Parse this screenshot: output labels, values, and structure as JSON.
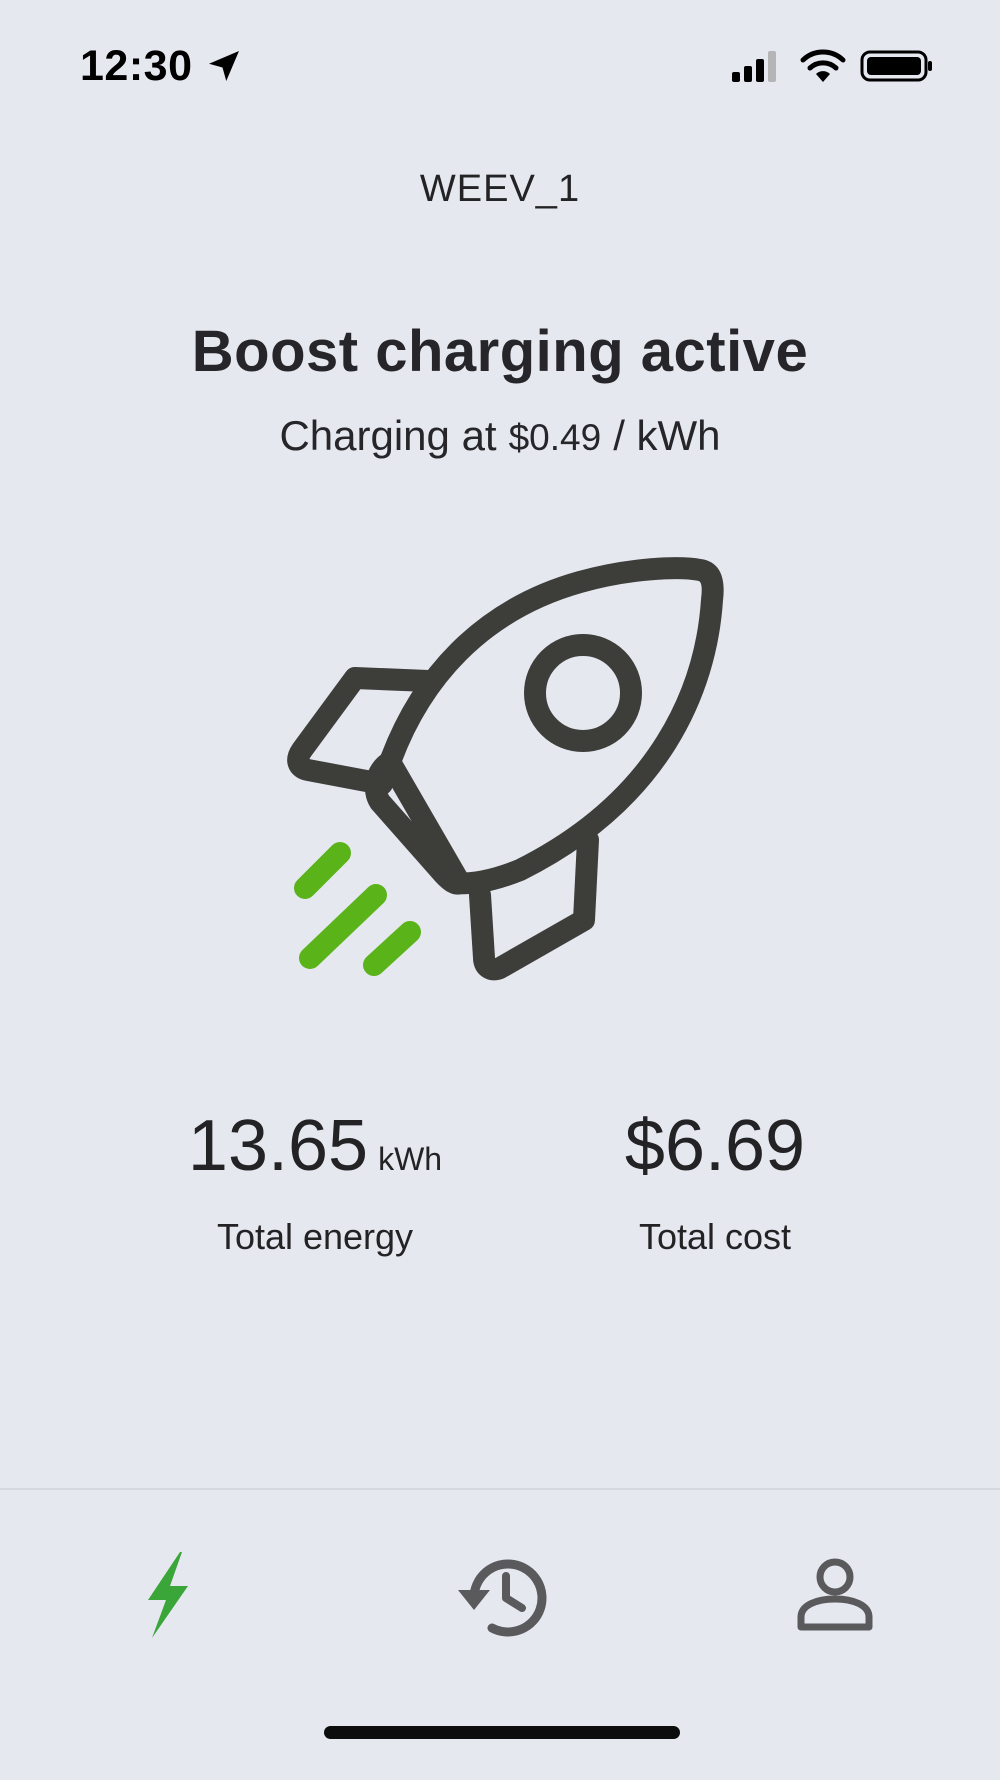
{
  "status_bar": {
    "time": "12:30"
  },
  "header": {
    "device_name": "WEEV_1"
  },
  "main": {
    "title": "Boost charging active",
    "rate_prefix": "Charging at",
    "rate_value": "$0.49",
    "rate_suffix": "/ kWh",
    "illustration_icon": "rocket-icon"
  },
  "stats": {
    "energy": {
      "value": "13.65",
      "unit": "kWh",
      "label": "Total energy"
    },
    "cost": {
      "value": "$6.69",
      "label": "Total cost"
    }
  },
  "tabbar": {
    "tabs": [
      {
        "icon": "lightning-icon",
        "active": true
      },
      {
        "icon": "history-icon",
        "active": false
      },
      {
        "icon": "profile-icon",
        "active": false
      }
    ]
  },
  "colors": {
    "background": "#e6e8f0",
    "accent_green": "#5bb31a",
    "active_tab_green": "#3aa63a",
    "icon_dark": "#3d3d3a",
    "text": "#232325"
  }
}
